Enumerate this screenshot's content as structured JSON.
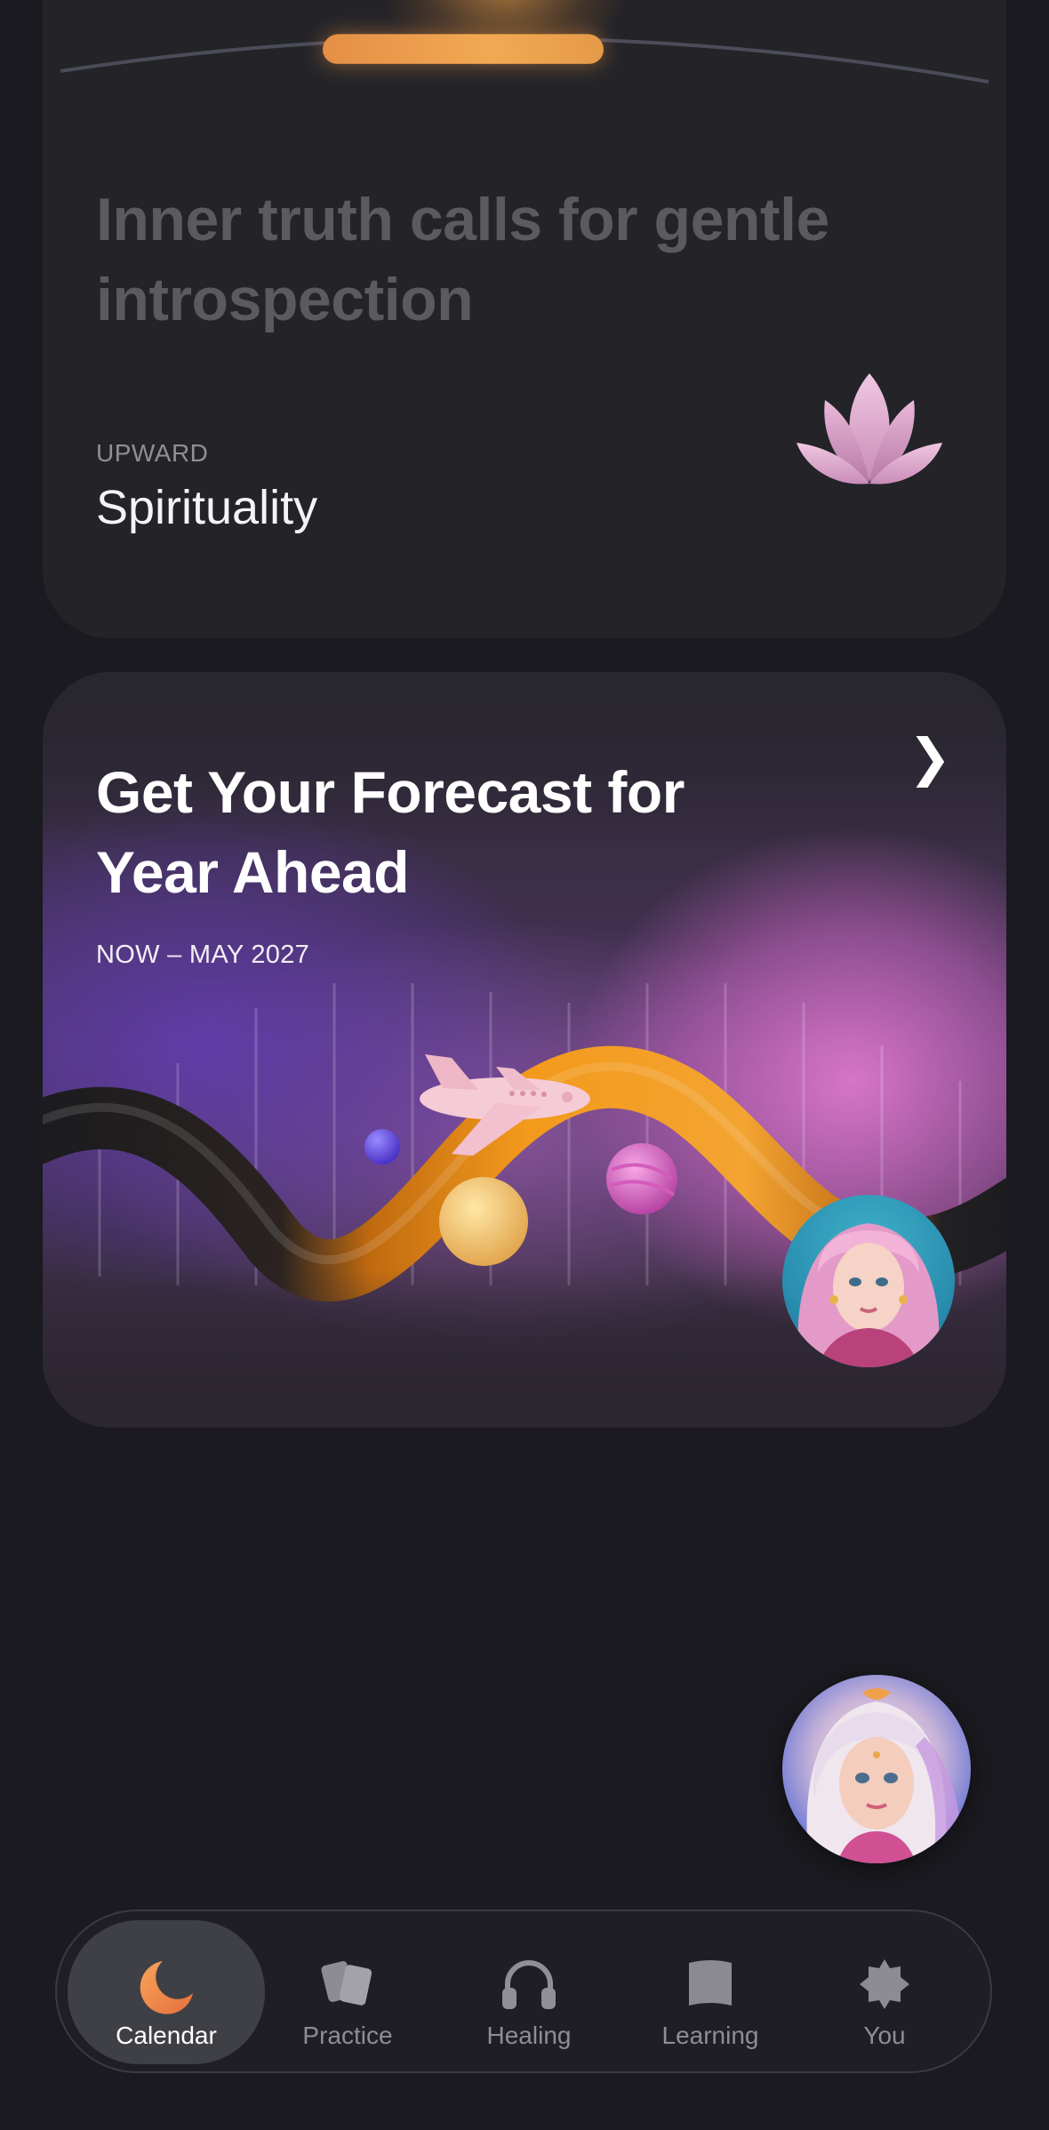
{
  "card_day": {
    "insight": "Inner truth calls for gentle introspection",
    "direction_label": "UPWARD",
    "topic": "Spirituality",
    "icon": "lotus-icon"
  },
  "forecast_card": {
    "title": "Get Your Forecast for Year Ahead",
    "date_range": "NOW – MAY 2027",
    "chevron_icon": "chevron-right-icon"
  },
  "assistant": {
    "icon": "assistant-avatar"
  },
  "tabbar": {
    "tabs": [
      {
        "label": "Calendar",
        "icon": "moon-icon",
        "active": true
      },
      {
        "label": "Practice",
        "icon": "cards-icon",
        "active": false
      },
      {
        "label": "Healing",
        "icon": "headphones-icon",
        "active": false
      },
      {
        "label": "Learning",
        "icon": "book-icon",
        "active": false
      },
      {
        "label": "You",
        "icon": "badge-icon",
        "active": false
      }
    ]
  },
  "colors": {
    "background": "#1a1a20",
    "card": "#232328",
    "accent_orange": "#f2a953",
    "lotus_pink": "#e2b1d2"
  }
}
